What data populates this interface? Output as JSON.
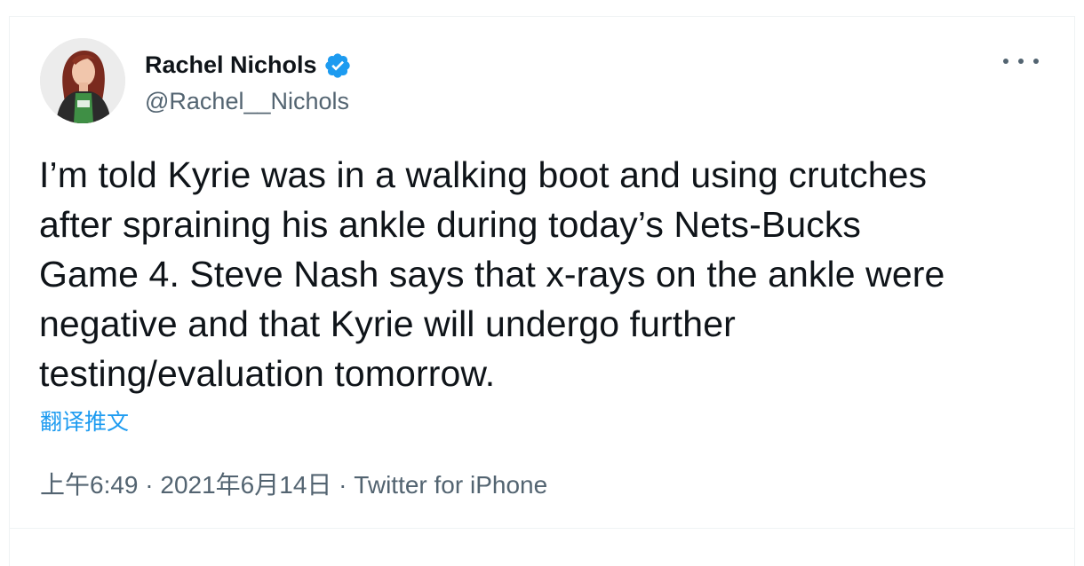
{
  "author": {
    "display_name": "Rachel Nichols",
    "handle": "@Rachel__Nichols",
    "verified": true
  },
  "tweet": {
    "lines": [
      "I’m told Kyrie was in a walking boot and using crutches",
      "after spraining his ankle during today’s Nets-Bucks",
      "Game 4. Steve Nash says that x-rays on the ankle were",
      "negative and that Kyrie will undergo further",
      "testing/evaluation tomorrow."
    ],
    "translate_label": "翻译推文"
  },
  "meta": {
    "time": "上午6:49",
    "separator": " · ",
    "date": "2021年6月14日",
    "source": "Twitter for iPhone"
  },
  "icons": {
    "verified_badge": "verified-badge-icon",
    "more": "more-horizontal-icon"
  },
  "colors": {
    "link_blue": "#1d9bf0",
    "text_primary": "#0f1419",
    "text_secondary": "#536471",
    "border": "#eff3f4"
  }
}
